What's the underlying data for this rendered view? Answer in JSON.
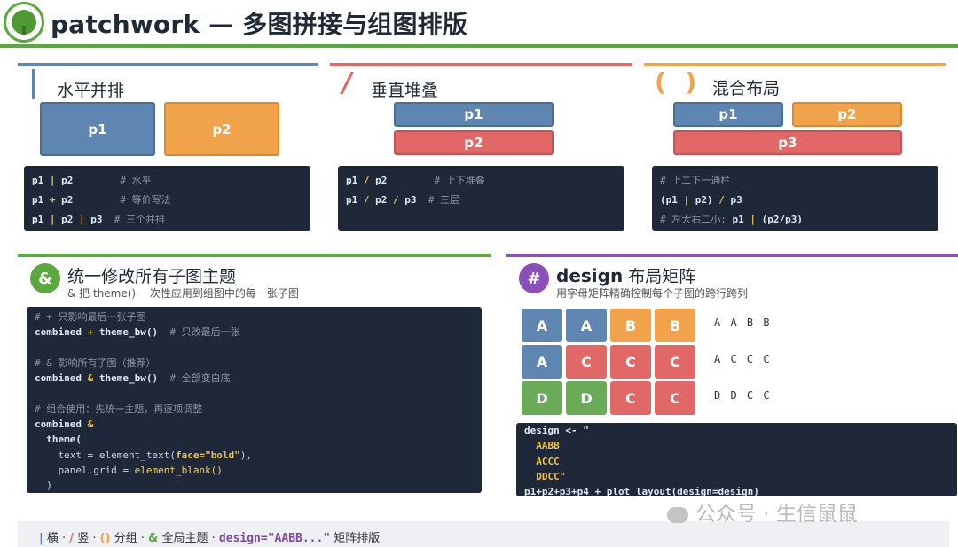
{
  "header": {
    "title": "patchwork — 多图拼接与组图排版"
  },
  "panels": {
    "horizontal": {
      "label": "水平并排",
      "boxes": [
        "p1",
        "p2"
      ],
      "code": [
        {
          "a": "p1",
          "op": "|",
          "b": "p2",
          "comment": "# 水平"
        },
        {
          "a": "p1",
          "op": "+",
          "b": "p2",
          "comment": "# 等价写法"
        },
        {
          "a": "p1",
          "op": "|",
          "b": "p2",
          "op2": "|",
          "c": "p3",
          "comment": "# 三个并排"
        }
      ]
    },
    "vertical": {
      "symbol": "/",
      "label": "垂直堆叠",
      "boxes": [
        "p1",
        "p2"
      ],
      "code": [
        {
          "a": "p1",
          "op": "/",
          "b": "p2",
          "comment": "# 上下堆叠"
        },
        {
          "a": "p1",
          "op": "/",
          "b": "p2",
          "op2": "/",
          "c": "p3",
          "comment": "# 三层"
        }
      ]
    },
    "mixed": {
      "symbol": "( )",
      "label": "混合布局",
      "boxes": [
        "p1",
        "p2",
        "p3"
      ],
      "code": {
        "line1": "# 上二下一通栏",
        "line2_a": "(p1",
        "line2_op": "|",
        "line2_b": "p2)",
        "line2_op2": "/",
        "line2_c": "p3",
        "line3_comment": "# 左大右二小:",
        "line3_a": "p1",
        "line3_op": "|",
        "line3_b": "(p2/p3)"
      }
    }
  },
  "theme_section": {
    "symbol": "&",
    "title": "统一修改所有子图主题",
    "subtitle": "& 把 theme() 一次性应用到组图中的每一张子图",
    "code": {
      "c1": "# + 只影响最后一张子图",
      "l2_a": "combined",
      "l2_op": "+",
      "l2_b": "theme_bw()",
      "l2_cm": "# 只改最后一张",
      "c3": "# & 影响所有子图（推荐）",
      "l4_a": "combined",
      "l4_op": "&",
      "l4_b": "theme_bw()",
      "l4_cm": "# 全部变白底",
      "c5": "# 组合使用：先统一主题，再逐项调整",
      "l6_a": "combined",
      "l6_op": "&",
      "l7": "theme(",
      "l8_a": "text = element_text(",
      "l8_b": "face=\"bold\"",
      "l8_c": "),",
      "l9_a": "panel.grid = ",
      "l9_b": "element_blank()",
      "l10": ")"
    }
  },
  "design_section": {
    "symbol": "#",
    "title_bold": "design",
    "title_rest": "布局矩阵",
    "subtitle": "用字母矩阵精确控制每个子图的跨行跨列",
    "grid": [
      [
        "A",
        "A",
        "B",
        "B"
      ],
      [
        "A",
        "C",
        "C",
        "C"
      ],
      [
        "D",
        "D",
        "C",
        "C"
      ]
    ],
    "row_labels": [
      "A A B B",
      "A C C C",
      "D D C C"
    ],
    "colors": {
      "A": "#5e86b0",
      "B": "#f0a34a",
      "C": "#e26868",
      "D": "#6aab58"
    },
    "code": {
      "l1": "design <- \"",
      "l2": "AABB",
      "l3": "ACCC",
      "l4": "DDCC\"",
      "l5": "p1+p2+p3+p4 + plot_layout(design=design)"
    }
  },
  "footer": {
    "bar1": "|",
    "t1": "横 ·",
    "slash": "/",
    "t2": "竖 ·",
    "paren": "()",
    "t3": "分组 ·",
    "amp": "&",
    "t4": "全局主题 ·",
    "design": "design=\"AABB...\"",
    "t5": "矩阵排版"
  },
  "watermark": {
    "text": "公众号 · 生信鼠鼠"
  }
}
